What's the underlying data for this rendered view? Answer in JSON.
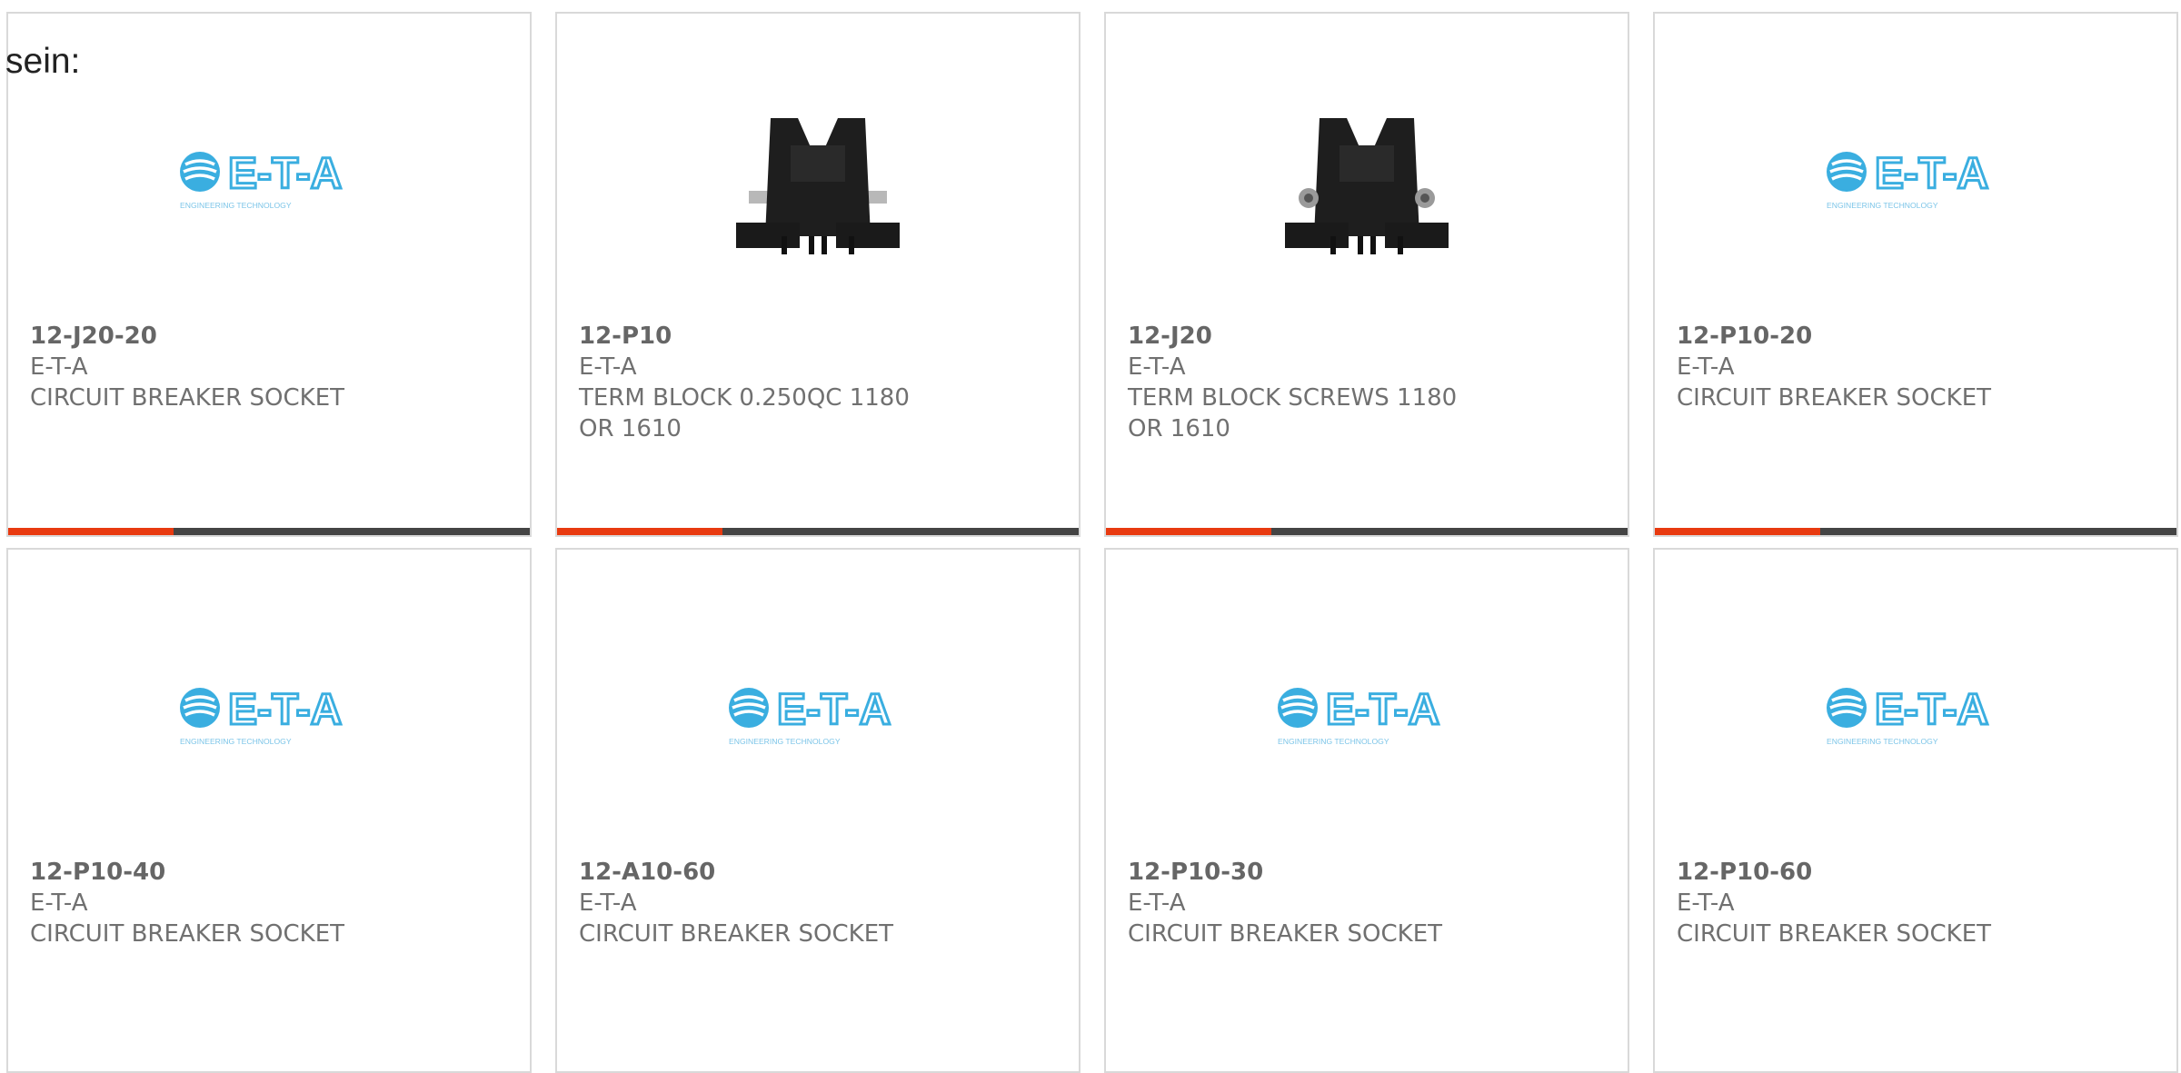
{
  "intro_text": "sein:",
  "colors": {
    "accent": "#e83a10",
    "bar": "#444444",
    "logo_blue": "#3aaee0"
  },
  "products": [
    {
      "part": "12-J20-20",
      "maker": "E-T-A",
      "desc": "CIRCUIT BREAKER SOCKET",
      "image": "eta-logo",
      "logo_text": "E-T-A",
      "logo_sub": "ENGINEERING TECHNOLOGY"
    },
    {
      "part": "12-P10",
      "maker": "E-T-A",
      "desc": "TERM BLOCK 0.250QC 1180 OR 1610",
      "image": "term-block-qc"
    },
    {
      "part": "12-J20",
      "maker": "E-T-A",
      "desc": "TERM BLOCK SCREWS 1180 OR 1610",
      "image": "term-block-screws"
    },
    {
      "part": "12-P10-20",
      "maker": "E-T-A",
      "desc": "CIRCUIT BREAKER SOCKET",
      "image": "eta-logo",
      "logo_text": "E-T-A",
      "logo_sub": "ENGINEERING TECHNOLOGY"
    },
    {
      "part": "12-P10-40",
      "maker": "E-T-A",
      "desc": "CIRCUIT BREAKER SOCKET",
      "image": "eta-logo",
      "logo_text": "E-T-A",
      "logo_sub": "ENGINEERING TECHNOLOGY"
    },
    {
      "part": "12-A10-60",
      "maker": "E-T-A",
      "desc": "CIRCUIT BREAKER SOCKET",
      "image": "eta-logo",
      "logo_text": "E-T-A",
      "logo_sub": "ENGINEERING TECHNOLOGY"
    },
    {
      "part": "12-P10-30",
      "maker": "E-T-A",
      "desc": "CIRCUIT BREAKER SOCKET",
      "image": "eta-logo",
      "logo_text": "E-T-A",
      "logo_sub": "ENGINEERING TECHNOLOGY"
    },
    {
      "part": "12-P10-60",
      "maker": "E-T-A",
      "desc": "CIRCUIT BREAKER SOCKET",
      "image": "eta-logo",
      "logo_text": "E-T-A",
      "logo_sub": "ENGINEERING TECHNOLOGY"
    }
  ]
}
